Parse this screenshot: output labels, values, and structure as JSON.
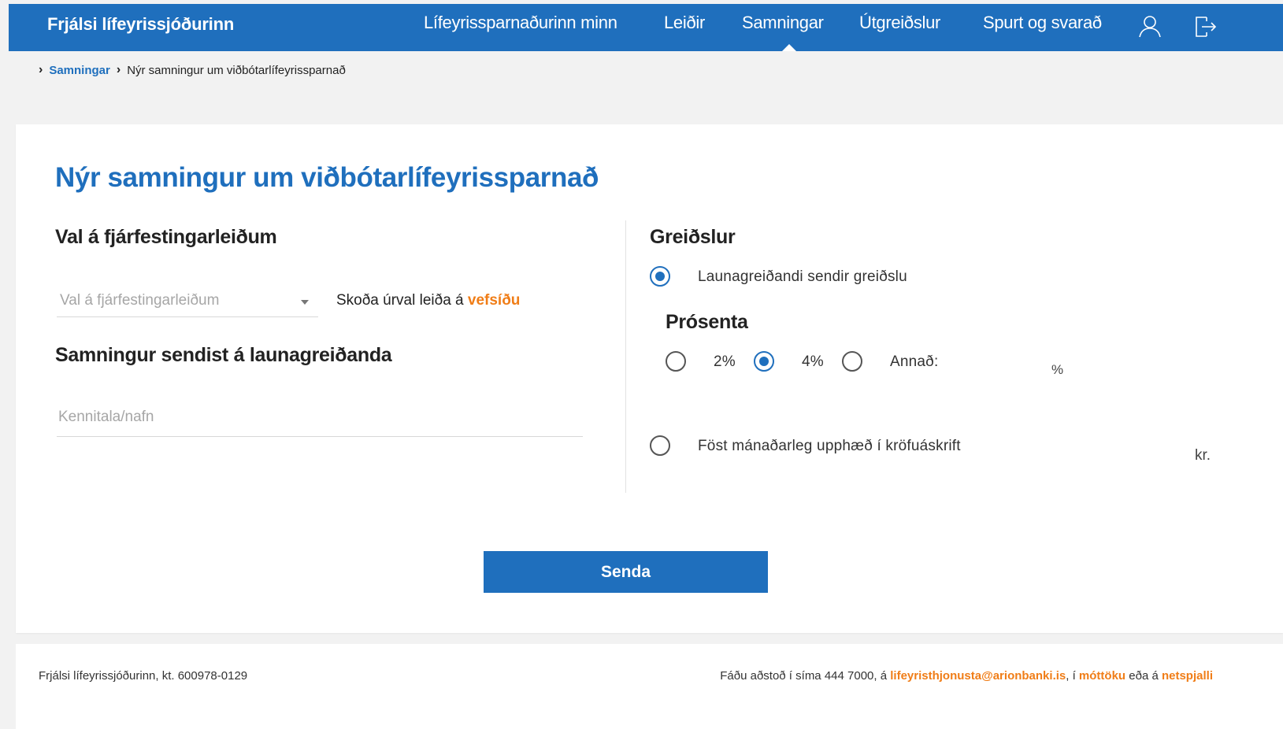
{
  "header": {
    "brand": "Frjálsi lífeyrissjóðurinn",
    "nav": [
      {
        "label": "Lífeyrissparnaðurinn minn"
      },
      {
        "label": "Leiðir"
      },
      {
        "label": "Samningar",
        "active": true
      },
      {
        "label": "Útgreiðslur"
      },
      {
        "label": "Spurt og svarað"
      }
    ],
    "icons": [
      "user-icon",
      "logout-icon"
    ]
  },
  "breadcrumb": {
    "parent": "Samningar",
    "current": "Nýr samningur um viðbótarlífeyrissparnað"
  },
  "form": {
    "title": "Nýr samningur um viðbótarlífeyrissparnað",
    "investment": {
      "heading": "Val á fjárfestingarleiðum",
      "select_placeholder": "Val á fjárfestingarleiðum",
      "view_text": "Skoða úrval leiða á ",
      "view_link": "vefsíðu"
    },
    "employer": {
      "heading": "Samningur sendist á launagreiðanda",
      "input_placeholder": "Kennitala/nafn"
    },
    "payments": {
      "heading": "Greiðslur",
      "option_employer": "Launagreiðandi sendir greiðslu",
      "option_employer_checked": true,
      "percent_heading": "Prósenta",
      "percent_options": [
        {
          "label": "2%",
          "checked": false
        },
        {
          "label": "4%",
          "checked": true
        },
        {
          "label": "Annað:",
          "checked": false
        }
      ],
      "percent_unit": "%",
      "option_fixed": "Föst mánaðarleg upphæð í kröfuáskrift",
      "option_fixed_checked": false,
      "fixed_unit": "kr."
    },
    "submit_label": "Senda"
  },
  "footer": {
    "left": "Frjálsi lífeyrissjóðurinn, kt. 600978-0129",
    "right_prefix": "Fáðu aðstoð í síma 444 7000, á ",
    "email": "lifeyristhjonusta@arionbanki.is",
    "right_mid": ", í ",
    "reception": "móttöku",
    "right_or": " eða á ",
    "chat": "netspjalli"
  },
  "colors": {
    "primary": "#1f6fbd",
    "accent": "#f07d17",
    "background": "#f2f2f2"
  }
}
